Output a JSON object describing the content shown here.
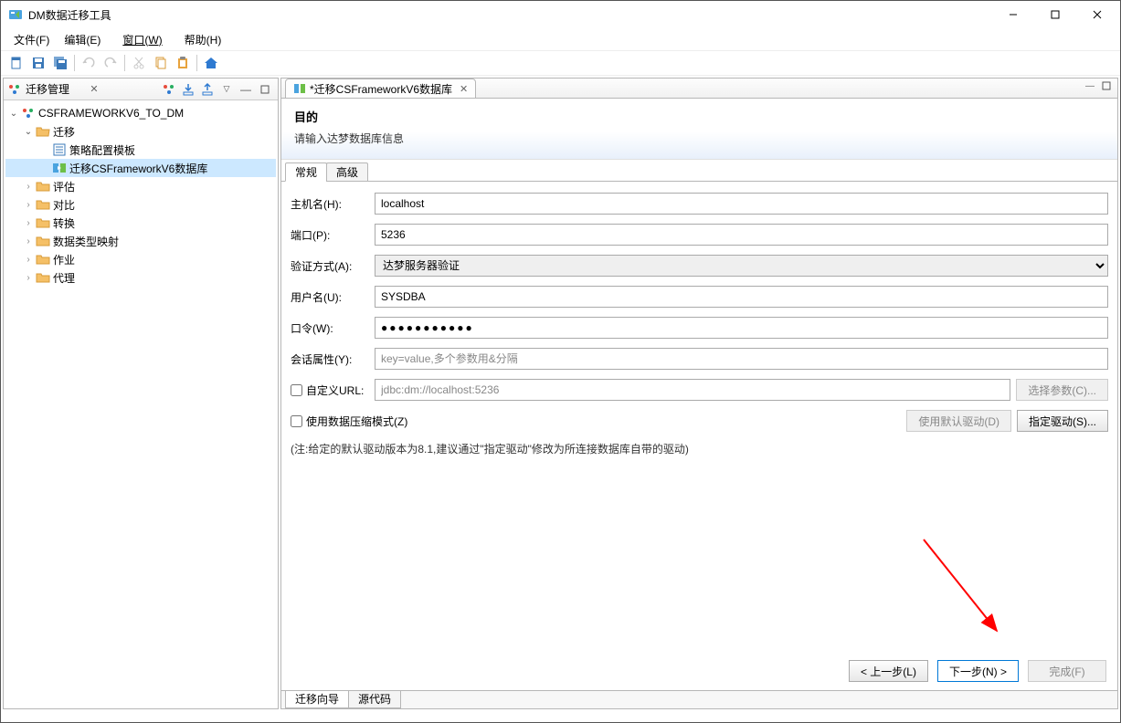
{
  "window": {
    "title": "DM数据迁移工具"
  },
  "menubar": {
    "file": "文件(F)",
    "edit": "编辑(E)",
    "window": "窗口(W)",
    "help": "帮助(H)"
  },
  "left_panel": {
    "title": "迁移管理",
    "tree": {
      "root": "CSFRAMEWORKV6_TO_DM",
      "node_migrate": "迁移",
      "node_strategy_template": "策略配置模板",
      "node_migrate_db": "迁移CSFrameworkV6数据库",
      "node_evaluate": "评估",
      "node_compare": "对比",
      "node_convert": "转换",
      "node_type_mapping": "数据类型映射",
      "node_job": "作业",
      "node_agent": "代理"
    }
  },
  "editor": {
    "tab_title": "*迁移CSFrameworkV6数据库",
    "header_title": "目的",
    "header_subtitle": "请输入达梦数据库信息",
    "inner_tab_general": "常规",
    "inner_tab_advanced": "高级",
    "form": {
      "host_label": "主机名(H):",
      "host_value": "localhost",
      "port_label": "端口(P):",
      "port_value": "5236",
      "auth_label": "验证方式(A):",
      "auth_value": "达梦服务器验证",
      "user_label": "用户名(U):",
      "user_value": "SYSDBA",
      "password_label": "口令(W):",
      "password_value": "●●●●●●●●●●●",
      "session_label": "会话属性(Y):",
      "session_placeholder": "key=value,多个参数用&分隔",
      "custom_url_label": "自定义URL:",
      "custom_url_value": "jdbc:dm://localhost:5236",
      "select_params_btn": "选择参数(C)...",
      "compress_label": "使用数据压缩模式(Z)",
      "use_default_driver_btn": "使用默认驱动(D)",
      "specify_driver_btn": "指定驱动(S)...",
      "note": "(注:给定的默认驱动版本为8.1,建议通过\"指定驱动\"修改为所连接数据库自带的驱动)"
    },
    "wizard": {
      "back": "< 上一步(L)",
      "next": "下一步(N) >",
      "finish": "完成(F)"
    },
    "bottom_tab_wizard": "迁移向导",
    "bottom_tab_source": "源代码"
  }
}
